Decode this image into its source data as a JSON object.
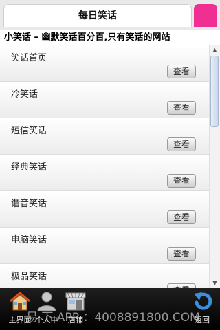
{
  "header": {
    "title": "每日笑话"
  },
  "subheader": {
    "text": "小笑话 – 幽默笑话百分百,只有笑话的网站"
  },
  "list": {
    "button_label": "查看",
    "items": [
      {
        "label": "笑话首页"
      },
      {
        "label": "冷笑话"
      },
      {
        "label": "短信笑话"
      },
      {
        "label": "经典笑话"
      },
      {
        "label": "谐音笑话"
      },
      {
        "label": "电脑笑话"
      },
      {
        "label": "极品笑话"
      }
    ]
  },
  "bottom_nav": {
    "home": {
      "label": "主界面",
      "icon": "home-icon"
    },
    "profile": {
      "label": "个人中",
      "icon": "person-icon"
    },
    "store": {
      "label": "店铺",
      "icon": "store-icon"
    },
    "back": {
      "label": "返回",
      "icon": "back-arrow-icon"
    }
  },
  "watermark": {
    "text": "易 下 APP ：4008891800.COM"
  },
  "colors": {
    "accent": "#f02f92",
    "bar_dark": "#111111",
    "scroll_thumb": "#c9d7ea"
  }
}
